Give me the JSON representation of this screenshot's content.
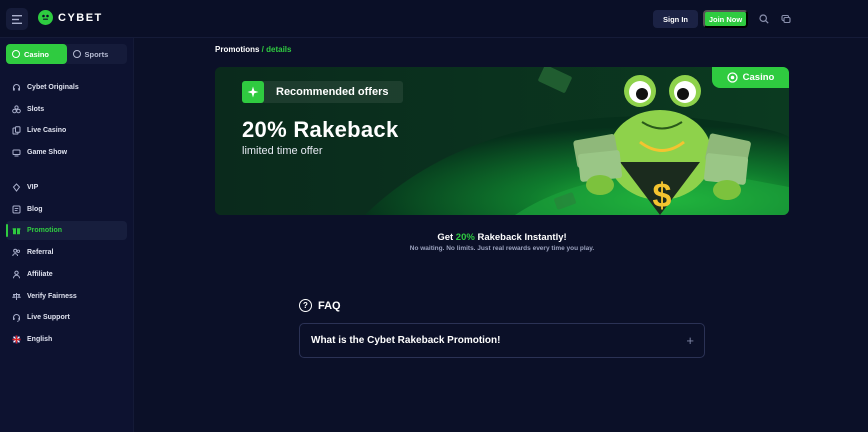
{
  "header": {
    "logo_text": "CYBET",
    "signin_label": "Sign In",
    "join_label": "Join Now",
    "colors": {
      "accent": "#2fcb40",
      "bg": "#0a0f27"
    }
  },
  "sidebar": {
    "tabs": [
      {
        "label": "Casino",
        "active": true
      },
      {
        "label": "Sports",
        "active": false
      }
    ],
    "items": [
      {
        "label": "Cybet Originals",
        "icon": "headset-icon"
      },
      {
        "label": "Slots",
        "icon": "slots-icon"
      },
      {
        "label": "Live Casino",
        "icon": "cards-icon"
      },
      {
        "label": "Game Show",
        "icon": "stage-icon"
      },
      {
        "label": "VIP",
        "icon": "vip-icon"
      },
      {
        "label": "Blog",
        "icon": "blog-icon"
      },
      {
        "label": "Promotion",
        "icon": "gift-icon",
        "active": true
      },
      {
        "label": "Referral",
        "icon": "users-icon"
      },
      {
        "label": "Affiliate",
        "icon": "user-icon"
      },
      {
        "label": "Verify Fairness",
        "icon": "scale-icon"
      },
      {
        "label": "Live Support",
        "icon": "support-icon"
      },
      {
        "label": "English",
        "icon": "uk-flag-icon"
      }
    ]
  },
  "main": {
    "breadcrumb": {
      "root": "Promotions",
      "sep": " / ",
      "current": "details"
    },
    "banner": {
      "tag": "Recommended offers",
      "title": "20% Rakeback",
      "subtitle": "limited time offer",
      "badge": "Casino"
    },
    "headline": {
      "pre": "Get ",
      "highlight": "20%",
      "post": " Rakeback Instantly!"
    },
    "subline": "No waiting. No limits. Just real rewards every time you play.",
    "faq": {
      "title": "FAQ",
      "items": [
        {
          "question": "What is the Cybet Rakeback Promotion!"
        }
      ]
    }
  }
}
